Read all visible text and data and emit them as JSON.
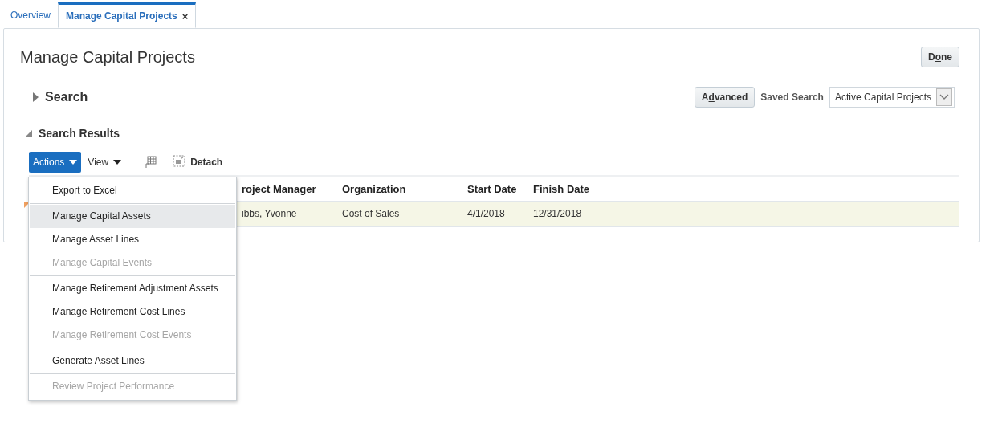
{
  "tabs": [
    {
      "label": "Overview",
      "selected": false,
      "closable": false
    },
    {
      "label": "Manage Capital Projects",
      "selected": true,
      "closable": true,
      "close": "×"
    }
  ],
  "page": {
    "title": "Manage Capital Projects",
    "done_button": [
      {
        "text": "D",
        "underlined": false
      },
      {
        "text": "o",
        "underlined": true
      },
      {
        "text": "ne",
        "underlined": false
      }
    ]
  },
  "search": {
    "label": "Search",
    "expanded": false,
    "advanced_button": [
      {
        "text": "A",
        "underlined": false
      },
      {
        "text": "d",
        "underlined": true
      },
      {
        "text": "vanced",
        "underlined": false
      }
    ],
    "saved_search_label": "Saved Search",
    "saved_search_value": "Active Capital Projects"
  },
  "results": {
    "label": "Search Results",
    "expanded": true,
    "toolbar": {
      "actions": "Actions",
      "view": "View",
      "detach": "Detach"
    },
    "columns": [
      "roject Manager",
      "Organization",
      "Start Date",
      "Finish Date"
    ],
    "rows": [
      {
        "selected": true,
        "cells": [
          "ibbs, Yvonne",
          "Cost of Sales",
          "4/1/2018",
          "12/31/2018"
        ]
      }
    ]
  },
  "actions_menu": [
    {
      "label": "Export to Excel",
      "disabled": false,
      "selected": false,
      "separator_before": false
    },
    {
      "label": "Manage Capital Assets",
      "disabled": false,
      "selected": true,
      "separator_before": true
    },
    {
      "label": "Manage Asset Lines",
      "disabled": false,
      "selected": false,
      "separator_before": false
    },
    {
      "label": "Manage Capital Events",
      "disabled": true,
      "selected": false,
      "separator_before": false
    },
    {
      "label": "Manage Retirement Adjustment Assets",
      "disabled": false,
      "selected": false,
      "separator_before": true
    },
    {
      "label": "Manage Retirement Cost Lines",
      "disabled": false,
      "selected": false,
      "separator_before": false
    },
    {
      "label": "Manage Retirement Cost Events",
      "disabled": true,
      "selected": false,
      "separator_before": false
    },
    {
      "label": "Generate Asset Lines",
      "disabled": false,
      "selected": false,
      "separator_before": true
    },
    {
      "label": "Review Project Performance",
      "disabled": true,
      "selected": false,
      "separator_before": true
    }
  ]
}
